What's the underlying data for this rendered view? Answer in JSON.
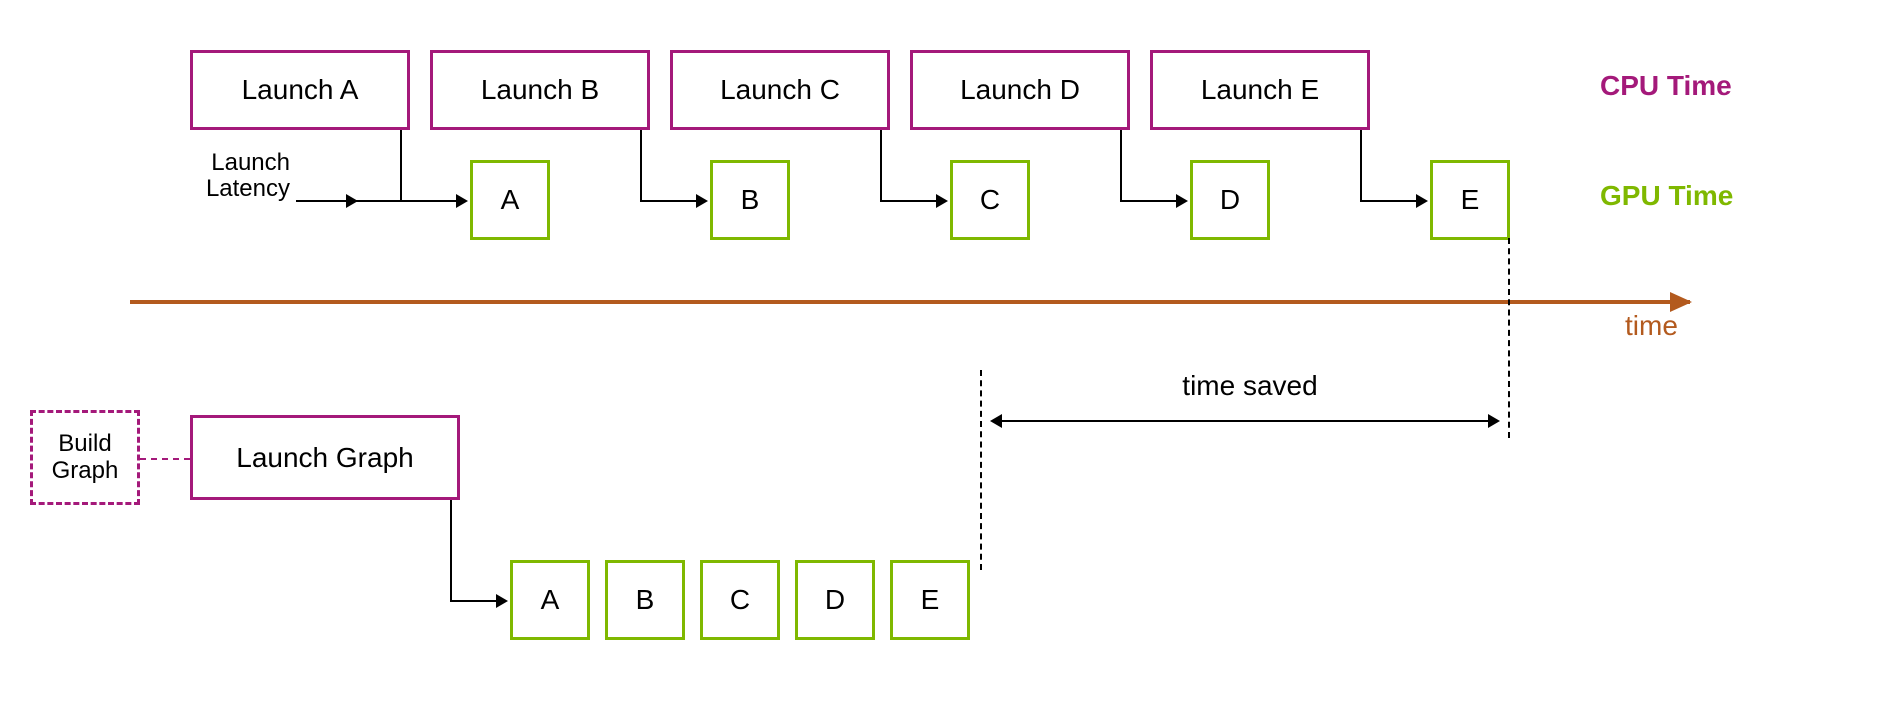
{
  "legend": {
    "cpu": "CPU Time",
    "gpu": "GPU Time",
    "time": "time"
  },
  "labels": {
    "launch_latency_l1": "Launch",
    "launch_latency_l2": "Latency",
    "time_saved": "time saved",
    "build_graph_l1": "Build",
    "build_graph_l2": "Graph",
    "launch_graph": "Launch Graph"
  },
  "top": {
    "cpu_boxes": [
      "Launch A",
      "Launch B",
      "Launch C",
      "Launch D",
      "Launch E"
    ],
    "gpu_boxes": [
      "A",
      "B",
      "C",
      "D",
      "E"
    ]
  },
  "bottom": {
    "gpu_boxes": [
      "A",
      "B",
      "C",
      "D",
      "E"
    ]
  }
}
